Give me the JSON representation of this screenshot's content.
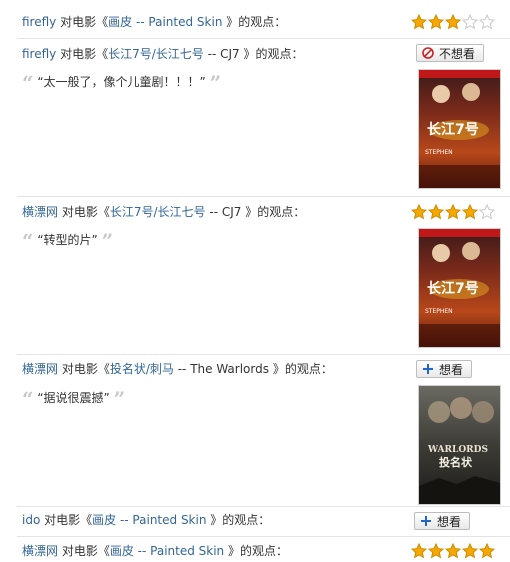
{
  "feed": [
    {
      "user": "firefly",
      "text_before": "对电影《",
      "movie": "画皮 -- Painted Skin",
      "text_after": "》的观点：",
      "stars": 3
    },
    {
      "user": "firefly",
      "text_before": "对电影《",
      "movie_part1": "长江7号/长江七号",
      "movie_part2": " -- CJ7",
      "text_after": "》的观点：",
      "button": "不想看",
      "button_icon": "no-entry-icon",
      "quote": "“太一般了，像个儿童剧！！！”",
      "poster": "cj7-poster",
      "poster_title": "长江7号",
      "poster_sub": "STEPHEN"
    },
    {
      "user": "横漂网",
      "text_before": "对电影《",
      "movie_part1": "长江7号/长江七号",
      "movie_part2": " -- CJ7",
      "text_after": "》的观点：",
      "stars": 4,
      "quote": "“转型的片”",
      "poster": "cj7-poster",
      "poster_title": "长江7号",
      "poster_sub": "STEPHEN"
    },
    {
      "user": "横漂网",
      "text_before": "对电影《",
      "movie_part1": "投名状/刺马",
      "movie_part2": " -- The Warlords",
      "text_after": "》的观点：",
      "button": "想看",
      "button_icon": "plus-icon",
      "quote": "“据说很震撼”",
      "poster": "warlords-poster",
      "poster_title": "WARLORDS",
      "poster_cn": "投名状"
    },
    {
      "user": "ido",
      "text_before": "对电影《",
      "movie": "画皮 -- Painted Skin",
      "text_after": "》的观点：",
      "button": "想看",
      "button_icon": "plus-icon"
    },
    {
      "user": "横漂网",
      "text_before": "对电影《",
      "movie": "画皮 -- Painted Skin",
      "text_after": "》的观点：",
      "stars": 5
    }
  ],
  "colors": {
    "link": "#336699",
    "star": "#f5a800",
    "no": "#cc2222",
    "plus": "#2266cc"
  }
}
